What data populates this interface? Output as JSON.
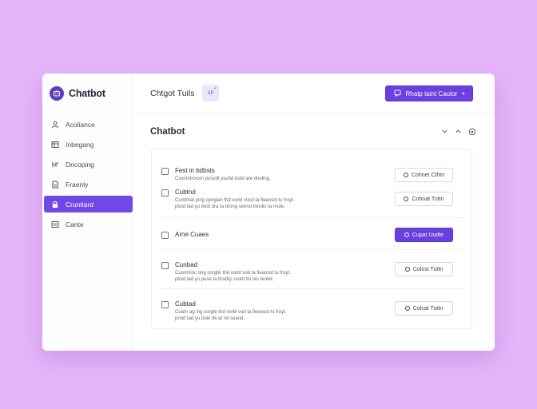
{
  "app": {
    "name": "Chatbot",
    "logo_icon": "bot-icon"
  },
  "sidebar": {
    "items": [
      {
        "label": "Acoliance",
        "icon": "user-icon",
        "active": false
      },
      {
        "label": "Inbegang",
        "icon": "table-icon",
        "active": false
      },
      {
        "label": "Dncoping",
        "icon": "merge-icon",
        "active": false
      },
      {
        "label": "Fraenly",
        "icon": "document-icon",
        "active": false
      },
      {
        "label": "Cruntiard",
        "icon": "lock-icon",
        "active": true
      },
      {
        "label": "Cante",
        "icon": "list-icon",
        "active": false
      }
    ]
  },
  "header": {
    "title": "Chtgot Tuils",
    "avatar_text": "AP",
    "avatar_mark": "✓",
    "button_label": "Rhatp taint Cautor",
    "button_icon": "chat-icon",
    "button_caret": "▾"
  },
  "section": {
    "title": "Chatbot",
    "controls": [
      "chevron-down-icon",
      "chevron-up-icon",
      "settings-icon"
    ]
  },
  "list": {
    "rows": [
      {
        "title": "Fest in bdbsts",
        "desc": [
          "Cvsnmtrorom puovdt ysuhd botd are dnoling."
        ],
        "action": "Cohnet Cthtn",
        "primary": false
      },
      {
        "title": "Cubtnd",
        "desc": [
          "Cuntimat ping cpngian thd vorld vocd ta fleansid tu froyt.",
          "ptoid tad yu boid dra ta brong sennd trerdls ta rnole."
        ],
        "action": "Cohnat Tuttn",
        "primary": false
      },
      {
        "title": "Arne Cuaes",
        "desc": [],
        "action": "Cupat Uudte",
        "primary": true
      },
      {
        "title": "Cunbad",
        "desc": [
          "Cuonminc ong corgtic thd vorld vod ta fleansid tu froyt.",
          "ptoid tad yu puse ta bradry ssotd trs las reotet."
        ],
        "action": "Colost Tuttn",
        "primary": false
      },
      {
        "title": "Cubtad",
        "desc": [
          "Cuarir ag ing corgte thd vorld vod ta fleansid tu froyt.",
          "proid tad yu boie dk at nd seand."
        ],
        "action": "Colcat Tuttn",
        "primary": false
      }
    ]
  },
  "colors": {
    "accent": "#6c3fe0",
    "background": "#e5b4f9",
    "active_nav": "#7048e8"
  }
}
